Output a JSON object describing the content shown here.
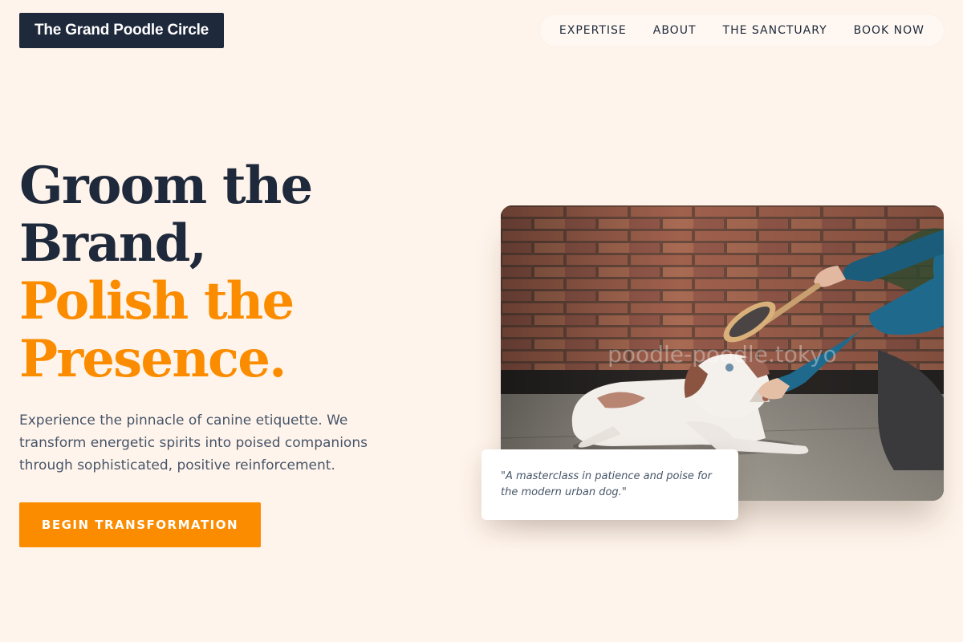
{
  "brand": {
    "name": "The Grand Poodle Circle"
  },
  "nav": {
    "items": [
      {
        "label": "EXPERTISE"
      },
      {
        "label": "ABOUT"
      },
      {
        "label": "THE SANCTUARY"
      },
      {
        "label": "BOOK NOW"
      }
    ]
  },
  "hero": {
    "line1": "Groom the",
    "line2": "Brand,",
    "line3": "Polish the",
    "line4": "Presence.",
    "description": "Experience the pinnacle of canine etiquette. We transform energetic spirits into poised companions through sophisticated, positive reinforcement.",
    "cta_label": "BEGIN TRANSFORMATION"
  },
  "image": {
    "watermark": "poodle-poodle.tokyo"
  },
  "quote": {
    "text": "\"A masterclass in patience and poise for the modern urban dog.\""
  },
  "colors": {
    "background": "#fff4eb",
    "navy": "#1e293b",
    "accent": "#fb8c00",
    "body_text": "#475569"
  }
}
